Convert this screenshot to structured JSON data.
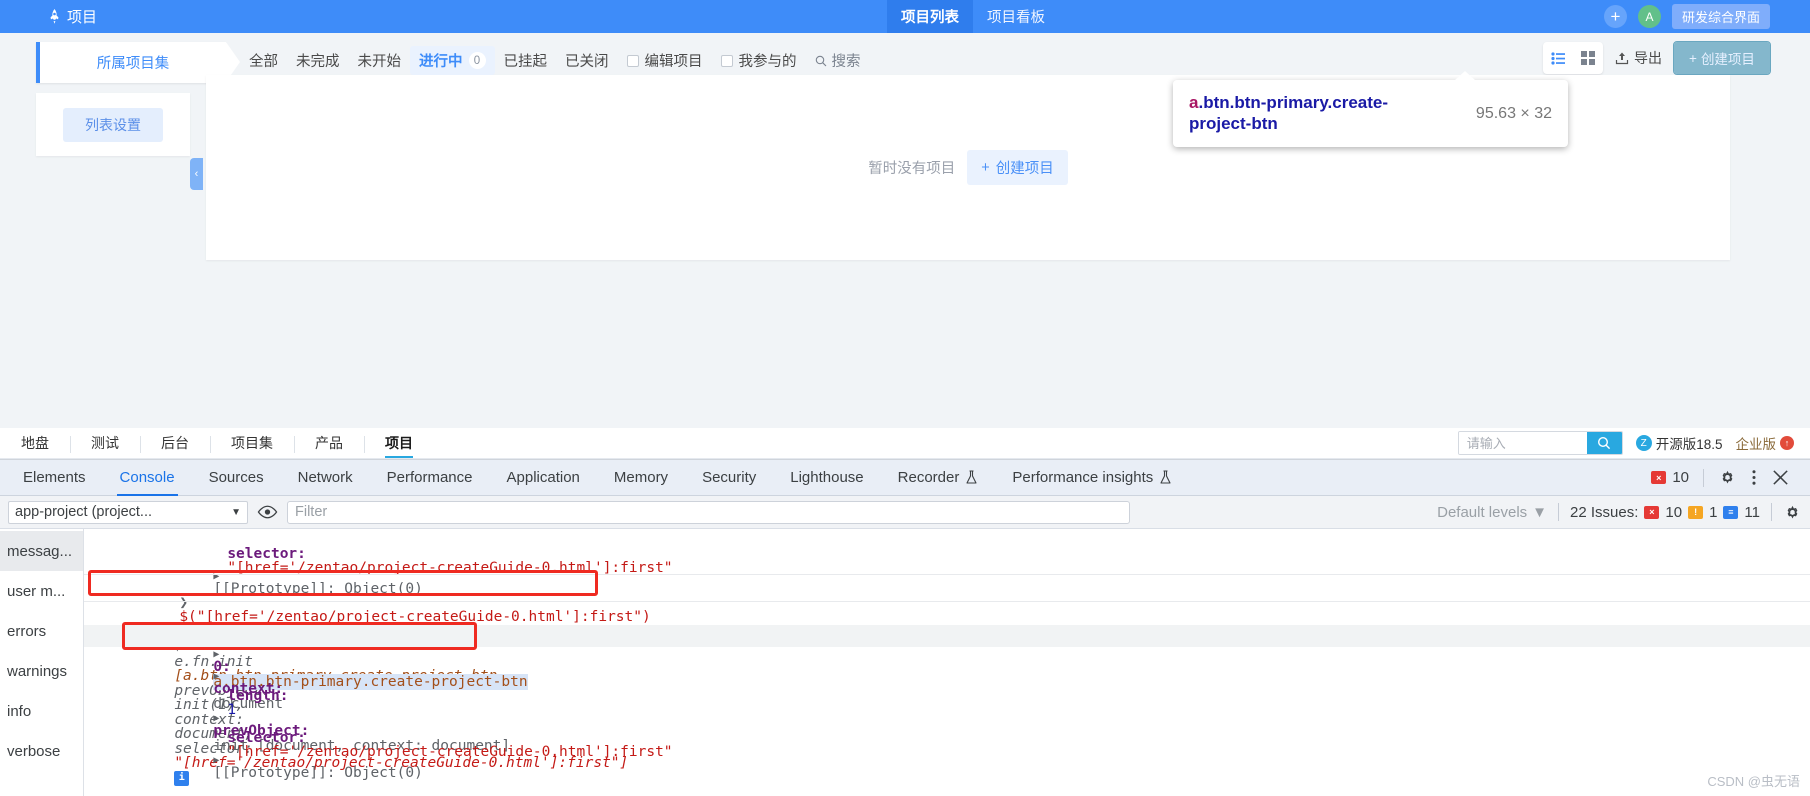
{
  "app": {
    "brand": {
      "label": "项目",
      "icon": "rocket-icon"
    },
    "header_tabs": [
      {
        "label": "项目列表",
        "active": true
      },
      {
        "label": "项目看板",
        "active": false
      }
    ],
    "header_right": {
      "add_label": "+",
      "avatar_initial": "A",
      "ui_chip": "研发综合界面"
    },
    "scope_tab": "所属项目集",
    "filters": [
      {
        "label": "全部",
        "active": false
      },
      {
        "label": "未完成",
        "active": false
      },
      {
        "label": "未开始",
        "active": false
      },
      {
        "label": "进行中",
        "active": true,
        "count": "0"
      },
      {
        "label": "已挂起",
        "active": false
      },
      {
        "label": "已关闭",
        "active": false
      }
    ],
    "checkboxes": [
      {
        "label": "编辑项目",
        "checked": false
      },
      {
        "label": "我参与的",
        "checked": false
      }
    ],
    "search_label": "搜索",
    "toolbar_right": {
      "list_view_icon": "list-view-icon",
      "grid_view_icon": "grid-view-icon",
      "export_label": "导出",
      "export_icon": "export-icon",
      "create_label": "创建项目"
    },
    "side_panel": {
      "list_settings": "列表设置",
      "collapse_icon": "chevron-left-icon"
    },
    "empty_state": {
      "text": "暂时没有项目",
      "button": "创建项目"
    }
  },
  "inspector_tooltip": {
    "tag": "a",
    "classes": ".btn.btn-primary.create-project-btn",
    "dimensions": "95.63 × 32"
  },
  "subnav": {
    "items": [
      {
        "label": "地盘",
        "active": false
      },
      {
        "label": "测试",
        "active": false
      },
      {
        "label": "后台",
        "active": false
      },
      {
        "label": "项目集",
        "active": false
      },
      {
        "label": "产品",
        "active": false
      },
      {
        "label": "项目",
        "active": true
      }
    ],
    "search_placeholder": "请输入",
    "search_icon": "magnifier-icon",
    "version_label": "开源版18.5",
    "enterprise_label": "企业版",
    "upgrade_icon": "upgrade-arrow-icon"
  },
  "devtools": {
    "tabs": [
      {
        "label": "Elements",
        "active": false
      },
      {
        "label": "Console",
        "active": true
      },
      {
        "label": "Sources",
        "active": false
      },
      {
        "label": "Network",
        "active": false
      },
      {
        "label": "Performance",
        "active": false
      },
      {
        "label": "Application",
        "active": false
      },
      {
        "label": "Memory",
        "active": false
      },
      {
        "label": "Security",
        "active": false
      },
      {
        "label": "Lighthouse",
        "active": false
      },
      {
        "label": "Recorder",
        "active": false,
        "icon": "flask-icon"
      },
      {
        "label": "Performance insights",
        "active": false,
        "icon": "flask-icon"
      }
    ],
    "tabbar_right": {
      "error_count": "10",
      "settings_icon": "gear-icon",
      "more_icon": "kebab-menu-icon",
      "close_icon": "close-icon"
    },
    "console_toolbar": {
      "context": "app-project (project...",
      "eye_icon": "eye-icon",
      "filter_placeholder": "Filter",
      "levels_label": "Default levels",
      "issues_label": "22 Issues:",
      "issues_errors": "10",
      "issues_warnings": "1",
      "issues_info": "11",
      "settings_icon": "gear-icon"
    },
    "sidebar": [
      {
        "label": "messag...",
        "active": true
      },
      {
        "label": "user m...",
        "active": false
      },
      {
        "label": "errors",
        "active": false
      },
      {
        "label": "warnings",
        "active": false
      },
      {
        "label": "info",
        "active": false
      },
      {
        "label": "verbose",
        "active": false
      }
    ],
    "log": {
      "line_selector_key": "selector:",
      "line_selector_val": "\"[href='/zentao/project-createGuide-0.html']:first\"",
      "line_prototype": "[[Prototype]]: Object(0)",
      "input_command": "$(\"[href='/zentao/project-createGuide-0.html']:first\")",
      "result_head": "e.fn.init",
      "result_body_1": "[a.btn.btn-primary.create-project-btn,",
      "result_body_2": "prevObject:",
      "result_body_3": "init(1),",
      "result_body_4": "context:",
      "result_body_5": "document,",
      "result_body_6": "selector:",
      "result_body_7": "\"[href='/zentao/project-createGuide-0.html']:first\"]",
      "row_index": "0:",
      "row_index_val": "a.btn.btn-primary.create-project-btn",
      "row_context_key": "context:",
      "row_context_val": "document",
      "row_length_key": "length:",
      "row_length_val": "1",
      "row_prev_key": "prevObject:",
      "row_prev_val": "init [document, context: document]",
      "row_selector_key": "selector:",
      "row_selector_val": "\"[href='/zentao/project-createGuide-0.html']:first\"",
      "row_proto": "[[Prototype]]: Object(0)"
    }
  },
  "watermark": "CSDN @虫无语"
}
